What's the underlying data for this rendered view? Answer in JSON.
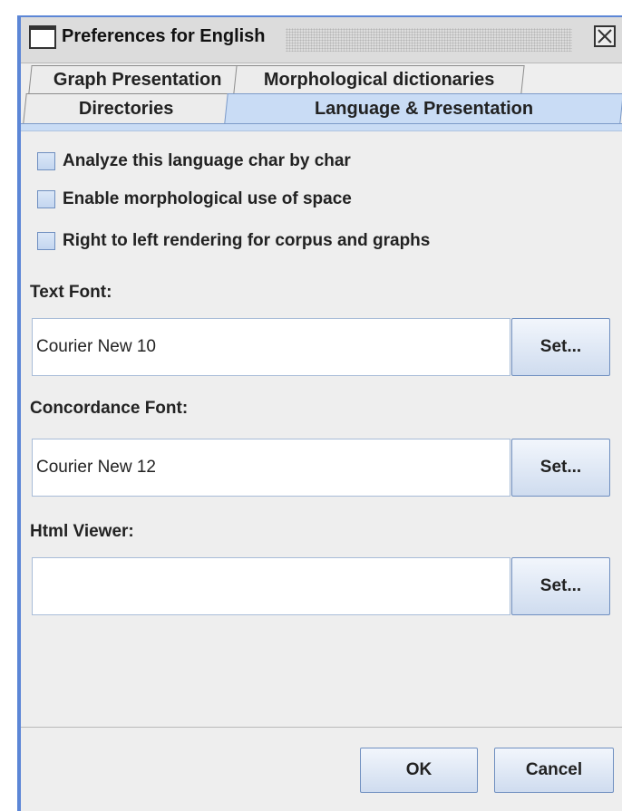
{
  "window": {
    "title": "Preferences for English",
    "close_icon": "close-icon"
  },
  "tabs": [
    {
      "label": "Graph Presentation",
      "selected": false
    },
    {
      "label": "Morphological dictionaries",
      "selected": false
    },
    {
      "label": "Directories",
      "selected": false
    },
    {
      "label": "Language & Presentation",
      "selected": true
    }
  ],
  "checkboxes": [
    {
      "label": "Analyze this language char by char",
      "checked": false
    },
    {
      "label": "Enable morphological use of space",
      "checked": false
    },
    {
      "label": "Right to left rendering for corpus and graphs",
      "checked": false
    }
  ],
  "text_font": {
    "label": "Text Font:",
    "value": "Courier New  10",
    "button": "Set..."
  },
  "concordance_font": {
    "label": "Concordance Font:",
    "value": "Courier New  12",
    "button": "Set..."
  },
  "html_viewer": {
    "label": "Html Viewer:",
    "value": "",
    "button": "Set..."
  },
  "footer": {
    "ok": "OK",
    "cancel": "Cancel"
  },
  "colors": {
    "accent": "#5c86d6",
    "selected_tab": "#c9dcf5"
  }
}
